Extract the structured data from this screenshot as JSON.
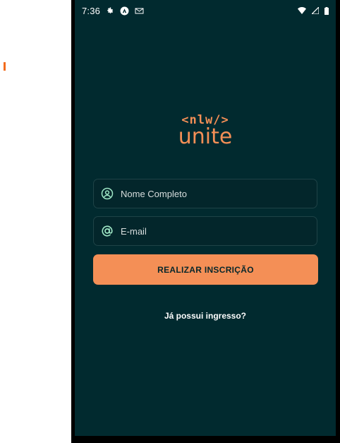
{
  "status_bar": {
    "time": "7:36",
    "left_icons": [
      "gear-icon",
      "app-icon",
      "gmail-icon"
    ],
    "right_icons": [
      "wifi-icon",
      "signal-icon",
      "battery-icon"
    ]
  },
  "logo": {
    "code": "<nlw/>",
    "word": "unite"
  },
  "form": {
    "name_placeholder": "Nome Completo",
    "email_placeholder": "E-mail",
    "submit_label": "REALIZAR INSCRIÇÃO"
  },
  "footer": {
    "link_label": "Já possui ingresso?"
  },
  "colors": {
    "background": "#012a2f",
    "accent": "#f48f56",
    "icon_green": "#9ee6c5",
    "field_border": "#1e4347"
  }
}
